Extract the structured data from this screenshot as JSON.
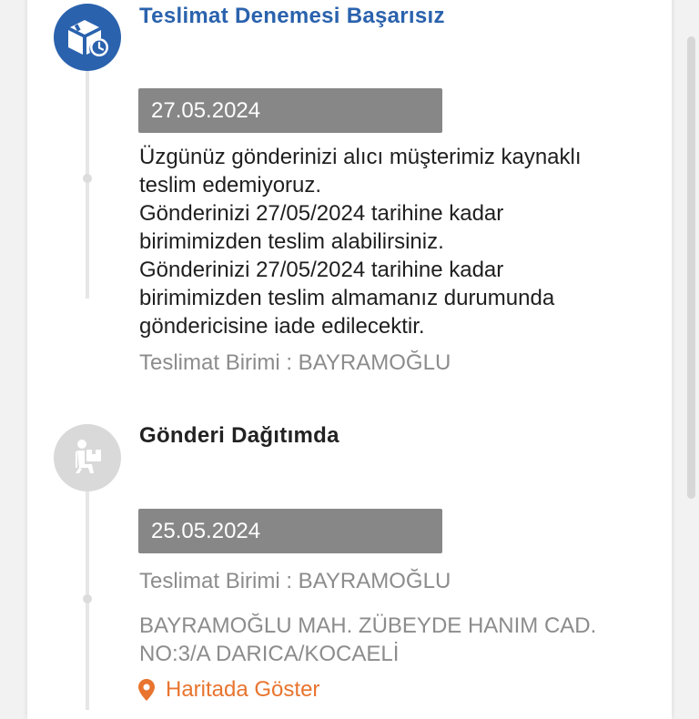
{
  "events": [
    {
      "title": "Teslimat Denemesi Başarısız",
      "icon": "delivery-box-clock-icon",
      "date": "27.05.2024",
      "description_lines": [
        "Üzgünüz gönderinizi alıcı müşterimiz kaynaklı",
        "teslim edemiyoruz.",
        "Gönderinizi 27/05/2024 tarihine kadar",
        "birimimizden teslim alabilirsiniz.",
        "Gönderinizi 27/05/2024 tarihine kadar",
        "birimimizden teslim almamanız durumunda",
        "göndericisine iade edilecektir."
      ],
      "unit": "Teslimat Birimi : BAYRAMOĞLU"
    },
    {
      "title": "Gönderi Dağıtımda",
      "icon": "courier-icon",
      "date": "25.05.2024",
      "unit": "Teslimat Birimi : BAYRAMOĞLU",
      "address_lines": [
        "BAYRAMOĞLU MAH. ZÜBEYDE HANIM CAD.",
        "NO:3/A DARICA/KOCAELİ"
      ],
      "map_link": "Haritada Göster"
    }
  ],
  "colors": {
    "accent_blue": "#2a62ad",
    "date_bar": "#878787",
    "link_orange": "#e8742e",
    "muted_text": "#8c8c8c"
  }
}
